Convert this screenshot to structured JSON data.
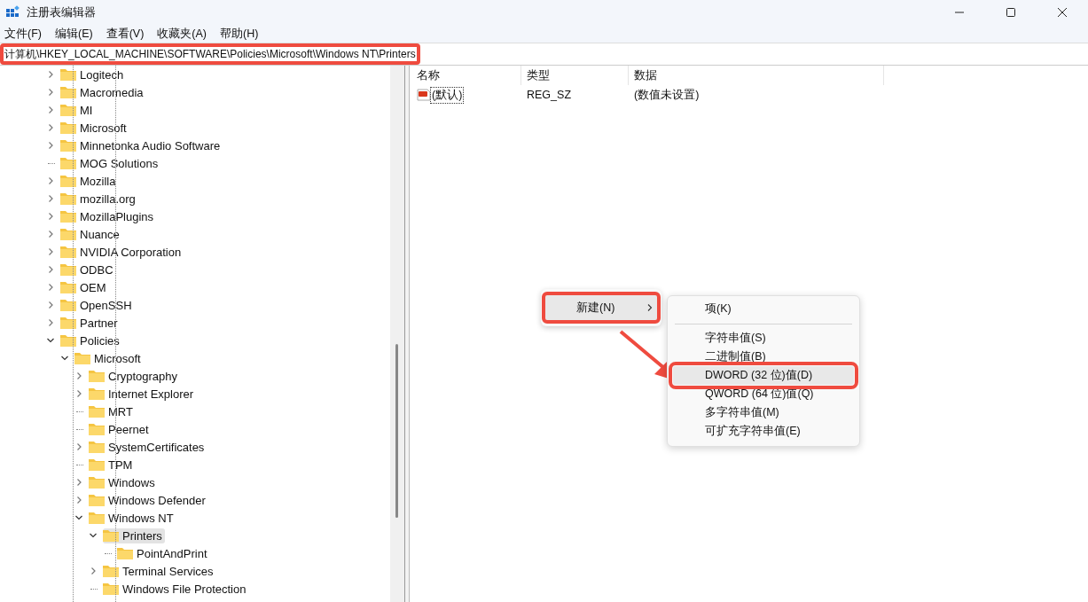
{
  "window": {
    "title": "注册表编辑器"
  },
  "menu_bar": [
    "文件(F)",
    "编辑(E)",
    "查看(V)",
    "收藏夹(A)",
    "帮助(H)"
  ],
  "address": {
    "path": "计算机\\HKEY_LOCAL_MACHINE\\SOFTWARE\\Policies\\Microsoft\\Windows NT\\Printers",
    "annotated": true
  },
  "tree": [
    {
      "label": "Logitech",
      "kind": "branch",
      "expanded": false,
      "selected": false
    },
    {
      "label": "Macromedia",
      "kind": "branch",
      "expanded": false,
      "selected": false
    },
    {
      "label": "MI",
      "kind": "branch",
      "expanded": false,
      "selected": false
    },
    {
      "label": "Microsoft",
      "kind": "branch",
      "expanded": false,
      "selected": false
    },
    {
      "label": "Minnetonka Audio Software",
      "kind": "branch",
      "expanded": false,
      "selected": false
    },
    {
      "label": "MOG Solutions",
      "kind": "leaf",
      "selected": false
    },
    {
      "label": "Mozilla",
      "kind": "branch",
      "expanded": false,
      "selected": false
    },
    {
      "label": "mozilla.org",
      "kind": "branch",
      "expanded": false,
      "selected": false
    },
    {
      "label": "MozillaPlugins",
      "kind": "branch",
      "expanded": false,
      "selected": false
    },
    {
      "label": "Nuance",
      "kind": "branch",
      "expanded": false,
      "selected": false
    },
    {
      "label": "NVIDIA Corporation",
      "kind": "branch",
      "expanded": false,
      "selected": false
    },
    {
      "label": "ODBC",
      "kind": "branch",
      "expanded": false,
      "selected": false
    },
    {
      "label": "OEM",
      "kind": "branch",
      "expanded": false,
      "selected": false
    },
    {
      "label": "OpenSSH",
      "kind": "branch",
      "expanded": false,
      "selected": false
    },
    {
      "label": "Partner",
      "kind": "branch",
      "expanded": false,
      "selected": false
    },
    {
      "label": "Policies",
      "kind": "branch",
      "expanded": true,
      "selected": false,
      "children": [
        {
          "label": "Microsoft",
          "kind": "branch",
          "expanded": true,
          "selected": false,
          "children": [
            {
              "label": "Cryptography",
              "kind": "branch",
              "expanded": false,
              "selected": false
            },
            {
              "label": "Internet Explorer",
              "kind": "branch",
              "expanded": false,
              "selected": false
            },
            {
              "label": "MRT",
              "kind": "leaf",
              "selected": false
            },
            {
              "label": "Peernet",
              "kind": "leaf",
              "selected": false
            },
            {
              "label": "SystemCertificates",
              "kind": "branch",
              "expanded": false,
              "selected": false
            },
            {
              "label": "TPM",
              "kind": "leaf",
              "selected": false
            },
            {
              "label": "Windows",
              "kind": "branch",
              "expanded": false,
              "selected": false
            },
            {
              "label": "Windows Defender",
              "kind": "branch",
              "expanded": false,
              "selected": false
            },
            {
              "label": "Windows NT",
              "kind": "branch",
              "expanded": true,
              "selected": false,
              "children": [
                {
                  "label": "Printers",
                  "kind": "branch",
                  "expanded": true,
                  "selected": true,
                  "children": [
                    {
                      "label": "PointAndPrint",
                      "kind": "leaf",
                      "selected": false
                    }
                  ]
                },
                {
                  "label": "Terminal Services",
                  "kind": "branch",
                  "expanded": false,
                  "selected": false
                },
                {
                  "label": "Windows File Protection",
                  "kind": "leaf",
                  "selected": false
                }
              ]
            }
          ]
        }
      ]
    }
  ],
  "values": {
    "columns": [
      "名称",
      "类型",
      "数据"
    ],
    "rows": [
      {
        "name": "(默认)",
        "type": "REG_SZ",
        "data": "(数值未设置)",
        "focused": true
      }
    ]
  },
  "context_menu": {
    "items": [
      {
        "label": "新建(N)",
        "has_submenu": true,
        "highlighted": true,
        "annotated": true
      }
    ]
  },
  "submenu": {
    "items": [
      {
        "label": "项(K)",
        "separator_after": true,
        "highlighted": false,
        "annotated": false
      },
      {
        "label": "字符串值(S)",
        "separator_after": false,
        "highlighted": false,
        "annotated": false
      },
      {
        "label": "二进制值(B)",
        "separator_after": false,
        "highlighted": false,
        "annotated": false
      },
      {
        "label": "DWORD (32 位)值(D)",
        "separator_after": false,
        "highlighted": true,
        "annotated": true
      },
      {
        "label": "QWORD (64 位)值(Q)",
        "separator_after": false,
        "highlighted": false,
        "annotated": false
      },
      {
        "label": "多字符串值(M)",
        "separator_after": false,
        "highlighted": false,
        "annotated": false
      },
      {
        "label": "可扩充字符串值(E)",
        "separator_after": false,
        "highlighted": false,
        "annotated": false
      }
    ]
  }
}
